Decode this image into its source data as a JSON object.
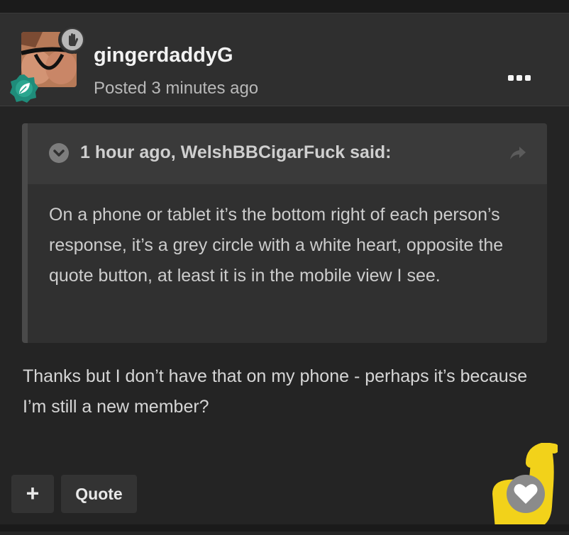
{
  "post": {
    "username": "gingerdaddyG",
    "posted": "Posted 3 minutes ago",
    "quote": {
      "citation": "1 hour ago, WelshBBCigarFuck said:",
      "text": "On a phone or tablet it’s the bottom right of each person’s response, it’s a grey circle with a white heart, opposite the quote button, at least it is in the mobile view I see."
    },
    "body": "Thanks but I don’t have that on my phone - perhaps it’s because I’m still a new member?"
  },
  "actions": {
    "plus_label": "+",
    "quote_label": "Quote"
  },
  "icons": {
    "more": "more-options-icon",
    "hand": "hand-icon",
    "leaf": "leaf-badge-icon",
    "chevron": "chevron-down-icon",
    "share": "share-icon",
    "heart": "heart-icon"
  },
  "colors": {
    "background": "#242424",
    "header": "#2f2f2f",
    "leaf_badge": "#1f8c7a",
    "highlight": "#f2d21a",
    "like_circle": "#8b8b8b"
  }
}
